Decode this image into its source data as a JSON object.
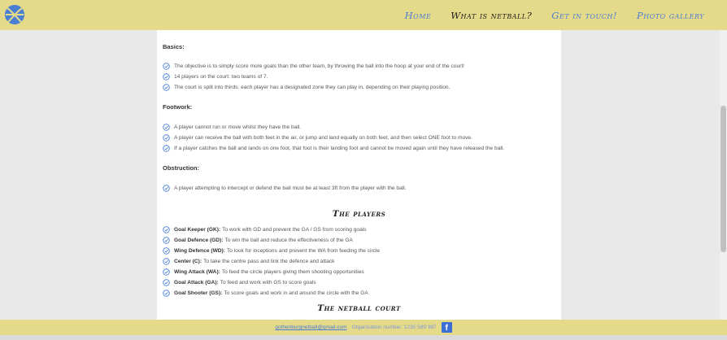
{
  "nav": {
    "items": [
      {
        "label": "Home",
        "active": false
      },
      {
        "label": "What is netball?",
        "active": true
      },
      {
        "label": "Get in touch!",
        "active": false
      },
      {
        "label": "Photo gallery",
        "active": false
      }
    ],
    "logo_icon": "netball-icon"
  },
  "sections": {
    "basics": {
      "heading": "Basics:",
      "items": [
        "The objective is to simply score more goals than the other team, by throwing the ball into the hoop at your end of the court!",
        "14 players on the court: two teams of 7.",
        "The court is split into thirds: each player has a designated zone they can play in, depending on their playing position."
      ]
    },
    "footwork": {
      "heading": "Footwork:",
      "items": [
        "A player cannot run or move whilst they have the ball.",
        "A player can receive the ball with both feet in the air, or jump and land equally on both feet, and then select ONE foot to move.",
        "If a player catches the ball and lands on one foot, that foot is their landing foot and cannot be moved again until they have released the ball."
      ]
    },
    "obstruction": {
      "heading": "Obstruction:",
      "items": [
        "A player attempting to intercept or defend the ball must be at least 3ft from the player with the ball."
      ]
    }
  },
  "players": {
    "title": "The players",
    "items": [
      {
        "role": "Goal Keeper (GK):",
        "desc": "To work with GD and prevent the GA / GS from scoring goals"
      },
      {
        "role": "Goal Defence (GD):",
        "desc": "To win the ball and reduce the effectiveness of the GA"
      },
      {
        "role": "Wing Defence (WD):",
        "desc": "To look for inceptions and prevent the WA from feeding the circle"
      },
      {
        "role": "Center (C):",
        "desc": "To take the centre pass and link the defence and attack"
      },
      {
        "role": "Wing Attack (WA):",
        "desc": "To feed the circle players giving them shooting opportunities"
      },
      {
        "role": "Goal Attack (GA):",
        "desc": "To feed and work with GS to score goals"
      },
      {
        "role": "Goal Shooter (GS):",
        "desc": "To score goals and work in and around the circle with the GA"
      }
    ]
  },
  "court": {
    "title": "The netball court"
  },
  "footer": {
    "email": "gothenburgnetball@gmail.com",
    "org": "Organisation number: 1235 589 987",
    "social_icon": "facebook-icon",
    "fb_glyph": "f"
  },
  "colors": {
    "navbar": "#e5d98a",
    "link": "#4a7fd4",
    "check": "#4a7fd4"
  }
}
